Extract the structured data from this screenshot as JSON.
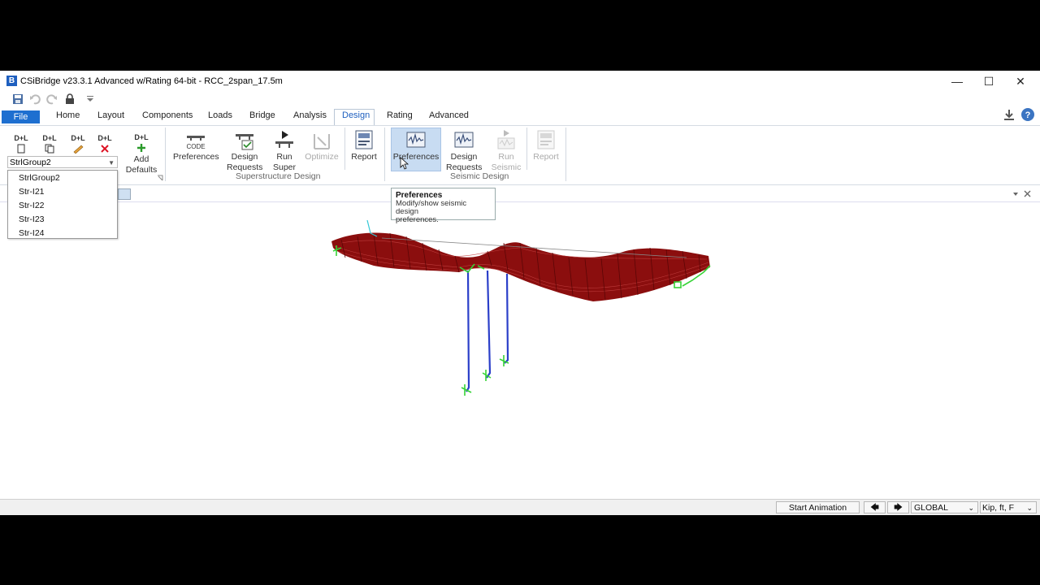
{
  "window": {
    "title": "CSiBridge v23.3.1 Advanced w/Rating 64-bit - RCC_2span_17.5m",
    "app_icon": "B",
    "minimize": "—",
    "maximize": "☐",
    "close": "✕"
  },
  "tabs": {
    "file": "File",
    "items": [
      "Home",
      "Layout",
      "Components",
      "Loads",
      "Bridge",
      "Analysis",
      "Design",
      "Rating",
      "Advanced"
    ],
    "active": "Design"
  },
  "ribbon": {
    "dl_icons": [
      "D+L",
      "D+L",
      "D+L",
      "D+L"
    ],
    "add_defaults": {
      "l1": "Add",
      "l2": "Defaults",
      "icon": "D+L"
    },
    "combo_value": "StrlGroup2",
    "code_text": "CODE",
    "super": {
      "preferences": "Preferences",
      "design_requests": {
        "l1": "Design",
        "l2": "Requests"
      },
      "run_super": {
        "l1": "Run",
        "l2": "Super"
      },
      "optimize": "Optimize",
      "report": "Report",
      "group_label": "Superstructure Design"
    },
    "seismic": {
      "preferences": "Preferences",
      "design_requests": {
        "l1": "Design",
        "l2": "Requests"
      },
      "run_seismic": {
        "l1": "Run",
        "l2": "Seismic"
      },
      "report": "Report",
      "group_label": "Seismic Design"
    }
  },
  "dropdown": {
    "items": [
      "StrlGroup2",
      "Str-I21",
      "Str-I22",
      "Str-I23",
      "Str-I24"
    ]
  },
  "tooltip": {
    "title": "Preferences",
    "line1": "Modify/show seismic design",
    "line2": "preferences."
  },
  "statusbar": {
    "start_animation": "Start Animation",
    "coord_system": "GLOBAL",
    "units": "Kip, ft, F"
  },
  "colors": {
    "deck": "#8b0e0e",
    "piers": "#2b3fc9",
    "supports": "#36d336",
    "accent": "#1e6fd0"
  }
}
